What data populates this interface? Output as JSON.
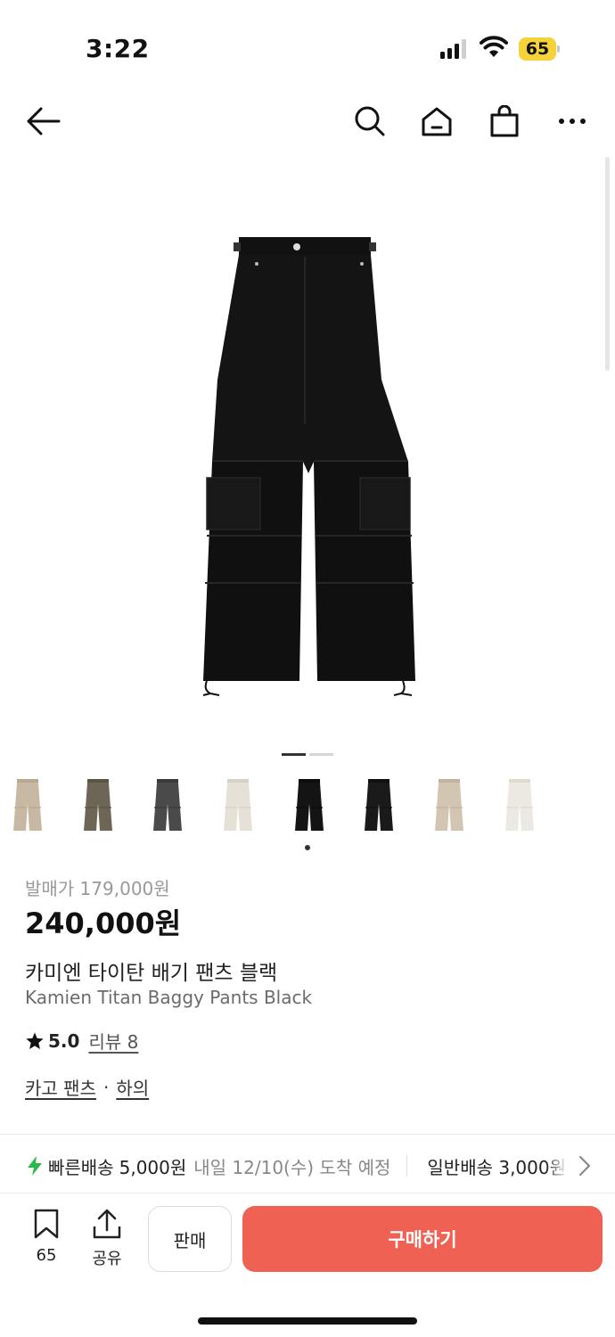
{
  "status_bar": {
    "time": "3:22",
    "battery": "65"
  },
  "nav": {
    "icons": [
      "arrow-left-icon",
      "search-icon",
      "home-icon",
      "shopping-bag-icon",
      "more-icon"
    ]
  },
  "gallery": {
    "page_count": 2,
    "active_page": 0
  },
  "thumbnails": [
    {
      "color": "#c7b8a4",
      "pocket": "#b8a890"
    },
    {
      "color": "#6d6656",
      "pocket": "#5b5445"
    },
    {
      "color": "#4a4a4a",
      "pocket": "#3a3a3a"
    },
    {
      "color": "#e6e1d6",
      "pocket": "#d8d2c4"
    },
    {
      "color": "#141414",
      "pocket": "#0c0c0c",
      "selected": true
    },
    {
      "color": "#1a1a1a",
      "pocket": "#101010"
    },
    {
      "color": "#d2c5b2",
      "pocket": "#c2b39d"
    },
    {
      "color": "#ece9e2",
      "pocket": "#dedad0"
    }
  ],
  "product": {
    "release_price": "발매가 179,000원",
    "price": "240,000원",
    "name_ko": "카미엔 타이탄 배기 팬츠 블랙",
    "name_en": "Kamien Titan Baggy Pants Black",
    "rating": "5.0",
    "review_label": "리뷰 8",
    "category": "카고 팬츠",
    "category_sep": "·",
    "subcategory": "하의"
  },
  "shipping": {
    "fast_label": "빠른배송",
    "fast_fee": "5,000원",
    "fast_eta": "내일 12/10(수) 도착 예정",
    "normal_label": "일반배송 3,000원"
  },
  "bottom_bar": {
    "save_count": "65",
    "share_label": "공유",
    "sell_label": "판매",
    "buy_label": "구매하기"
  },
  "colors": {
    "buy": "#ef6253",
    "flash": "#2bb84a",
    "battery": "#f5d13a"
  }
}
